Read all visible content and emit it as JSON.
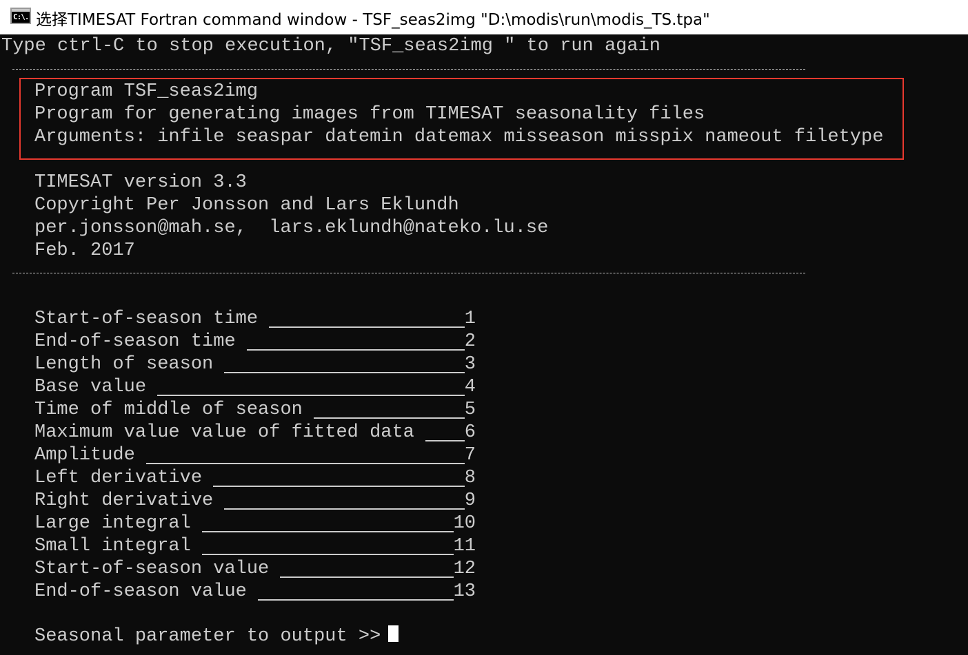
{
  "window": {
    "title": "选择TIMESAT Fortran command window  - TSF_seas2img  \"D:\\modis\\run\\modis_TS.tpa\"",
    "icon_text": "C:\\."
  },
  "console": {
    "intro": "Type ctrl-C to stop execution, \"TSF_seas2img \" to run again",
    "program_info": {
      "name": "Program TSF_seas2img",
      "description": "Program for generating images from TIMESAT seasonality files",
      "arguments": "Arguments: infile seaspar datemin datemax misseason misspix nameout filetype"
    },
    "credits": {
      "version": "TIMESAT version 3.3",
      "copyright": "Copyright Per Jonsson and Lars Eklundh",
      "emails": "per.jonsson@mah.se,  lars.eklundh@nateko.lu.se",
      "date": "Feb. 2017"
    },
    "menu": [
      {
        "label": "Start-of-season time",
        "number": "1"
      },
      {
        "label": "End-of-season time",
        "number": "2"
      },
      {
        "label": "Length of season",
        "number": "3"
      },
      {
        "label": "Base value",
        "number": "4"
      },
      {
        "label": "Time of middle of season",
        "number": "5"
      },
      {
        "label": "Maximum value value of fitted data",
        "number": "6"
      },
      {
        "label": "Amplitude",
        "number": "7"
      },
      {
        "label": "Left derivative",
        "number": "8"
      },
      {
        "label": "Right derivative",
        "number": "9"
      },
      {
        "label": "Large integral",
        "number": "10"
      },
      {
        "label": "Small integral",
        "number": "11"
      },
      {
        "label": "Start-of-season value",
        "number": "12"
      },
      {
        "label": "End-of-season value",
        "number": "13"
      }
    ],
    "prompt": "Seasonal parameter to output >>"
  },
  "colors": {
    "background": "#0c0c0c",
    "text": "#cccccc",
    "highlight_border": "#e8392f"
  }
}
